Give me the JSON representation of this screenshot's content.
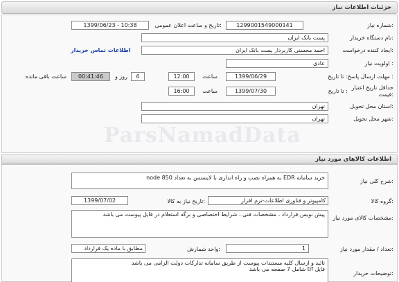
{
  "header": {
    "title": "جزئیات اطلاعات نیاز"
  },
  "details": {
    "need_number_label": "شماره نیاز:",
    "need_number": "1299001549000141",
    "announce_label": "تاریخ و ساعت اعلان عمومی:",
    "announce_value": "1399/06/23 - 10:38",
    "buyer_label": "نام دستگاه خریدار:",
    "buyer": "پست بانک ایران",
    "creator_label": "ایجاد کننده درخواست:",
    "creator": "احمد محسنی کاربردار پست بانک ایران",
    "contact_link": "اطلاعات تماس خریدار",
    "priority_label": "اولویت نیاز :",
    "priority": "عادی",
    "deadline_label": "مهلت ارسال پاسخ: تا تاریخ :",
    "deadline_date": "1399/06/29",
    "time_label": "ساعت",
    "deadline_time": "12:00",
    "days_value": "6",
    "days_label": "روز و",
    "remaining_time": "00:41:46",
    "remaining_label": "ساعت باقی مانده",
    "validity_label_1": "حداقل تاریخ اعتبار",
    "validity_label_2": "قیمت:",
    "validity_to": "تا تاریخ :",
    "validity_date": "1399/07/30",
    "validity_time_label": "ساعت",
    "validity_time": "16:00",
    "province_label": "استان محل تحویل:",
    "province": "تهران",
    "city_label": "شهر محل تحویل:",
    "city": "تهران"
  },
  "goods": {
    "section_title": "اطلاعات کالاهای مورد نیاز",
    "summary_label": "شرح کلی نیاز:",
    "summary": "خرید سامانه EDR به همراه نصب و راه اندازی با لایسنس به تعداد 850 node",
    "group_label": "گروه کالا:",
    "group": "کامپیوتر و فناوری اطلاعات-نرم افزار",
    "need_date_label": "تاریخ نیاز به کالا:",
    "need_date": "1399/07/02",
    "specs_label": "مشخصات کالای مورد نیاز:",
    "specs": "پیش نویس قرارداد ، مشخصات فنی ، شرایط اختصاصی و برگه استعلام در فایل پیوست می باشد",
    "qty_label": "تعداد / مقدار مورد نیاز:",
    "qty": "1",
    "unit_label": "واحد شمارش:",
    "unit": "مطابق با ماده یک قرارداد",
    "notes_label": "توضیحات خریدار:",
    "notes_line1": "تائید و ارسال کلیه مستندات پیوست از طریق سامانه تدارکات دولت الزامی می باشد",
    "notes_line2": "فایل tif شامل 7 صفحه می باشد"
  },
  "watermark": "ParsNamadData"
}
